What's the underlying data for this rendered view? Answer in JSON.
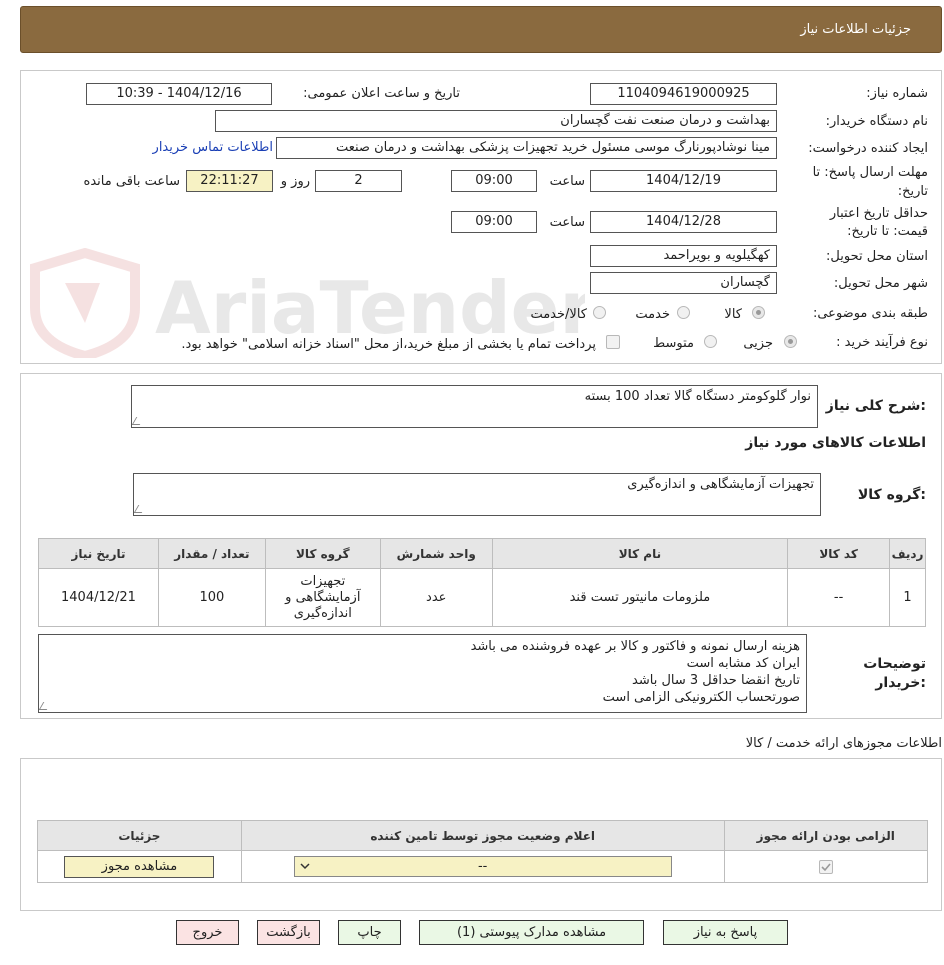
{
  "header": {
    "title": "جزئیات اطلاعات نیاز"
  },
  "watermark": {
    "text": "AriaTender.neT"
  },
  "form": {
    "need_number": {
      "label": "شماره نیاز:",
      "value": "1104094619000925"
    },
    "announce_datetime": {
      "label": "تاریخ و ساعت اعلان عمومی:",
      "value": "1404/12/16 - 10:39"
    },
    "buyer_org": {
      "label": "نام دستگاه خریدار:",
      "value": "بهداشت و درمان صنعت نفت گچساران"
    },
    "requester": {
      "label": "ایجاد کننده درخواست:",
      "value": "مینا نوشادپورنارگ موسی مسئول خرید تجهیزات پزشکی  بهداشت و درمان صنعت",
      "contact_link": "اطلاعات تماس خریدار"
    },
    "deadline": {
      "label_line1": "مهلت ارسال پاسخ: تا",
      "label_line2": "تاریخ:",
      "date": "1404/12/19",
      "time_label": "ساعت",
      "time": "09:00",
      "days": "2",
      "days_label": "روز و",
      "remaining": "22:11:27",
      "remaining_label": "ساعت باقی مانده"
    },
    "validity": {
      "label_line1": "حداقل تاریخ اعتبار",
      "label_line2": "قیمت: تا تاریخ:",
      "date": "1404/12/28",
      "time_label": "ساعت",
      "time": "09:00"
    },
    "province": {
      "label": "استان محل تحویل:",
      "value": "کهگیلویه و بویراحمد"
    },
    "city": {
      "label": "شهر محل تحویل:",
      "value": "گچساران"
    },
    "category": {
      "label": "طبقه بندی موضوعی:",
      "options": [
        "کالا",
        "خدمت",
        "کالا/خدمت"
      ],
      "selected": "کالا"
    },
    "purchase_type": {
      "label": "نوع فرآیند خرید :",
      "options": [
        "جزیی",
        "متوسط"
      ],
      "selected": "جزیی",
      "treasury_note": "پرداخت تمام یا بخشی از مبلغ خرید،از محل \"اسناد خزانه اسلامی\" خواهد بود."
    }
  },
  "summary": {
    "label": "شرح کلی نیاز:",
    "value": "نوار گلوکومتر دستگاه گالا تعداد 100 بسته"
  },
  "goods_info": {
    "title": "اطلاعات کالاهای مورد نیاز",
    "group_label": "گروه کالا:",
    "group_value": "تجهیزات آزمایشگاهی و اندازه‌گیری",
    "columns": [
      "ردیف",
      "کد کالا",
      "نام کالا",
      "واحد شمارش",
      "گروه کالا",
      "تعداد / مقدار",
      "تاریخ نیاز"
    ],
    "rows": [
      [
        "1",
        "--",
        "ملزومات مانیتور تست قند",
        "عدد",
        "تجهیزات آزمایشگاهی و اندازه‌گیری",
        "100",
        "1404/12/21"
      ]
    ]
  },
  "buyer_notes": {
    "label_line1": "توضیحات",
    "label_line2": "خریدار:",
    "lines": [
      "هزینه ارسال نمونه و فاکتور و کالا بر عهده فروشنده می باشد",
      "ایران کد مشابه است",
      "تاریخ انقضا حداقل 3 سال باشد",
      "صورتحساب الکترونیکی الزامی است"
    ]
  },
  "permits": {
    "title": "اطلاعات مجوزهای ارائه خدمت / کالا",
    "columns": [
      "الزامی بودن ارائه مجوز",
      "اعلام وضعیت مجوز توسط تامین کننده",
      "جزئیات"
    ],
    "select_value": "--",
    "view_button": "مشاهده مجوز"
  },
  "actions": {
    "reply": "پاسخ به نیاز",
    "attachments": "مشاهده مدارک پیوستی (1)",
    "print": "چاپ",
    "back": "بازگشت",
    "exit": "خروج"
  }
}
